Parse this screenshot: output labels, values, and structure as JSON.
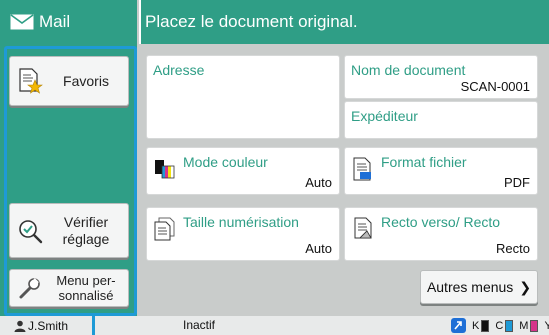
{
  "header": {
    "app_title": "Mail",
    "message": "Placez le document original."
  },
  "sidebar": {
    "favorites_label": "Favoris",
    "verify_label_1": "Vérifier",
    "verify_label_2": "réglage",
    "custom_menu_label_1": "Menu per-",
    "custom_menu_label_2": "sonnalisé"
  },
  "main": {
    "address": {
      "title": "Adresse"
    },
    "document_name": {
      "title": "Nom de document",
      "value": "SCAN-0001"
    },
    "sender": {
      "title": "Expéditeur"
    },
    "color_mode": {
      "title": "Mode couleur",
      "value": "Auto"
    },
    "file_format": {
      "title": "Format fichier",
      "value": "PDF"
    },
    "scan_size": {
      "title": "Taille numérisation",
      "value": "Auto"
    },
    "duplex": {
      "title": "Recto verso/ Recto",
      "value": "Recto"
    },
    "more_menus_label": "Autres menus"
  },
  "status_bar": {
    "user": "J.Smith",
    "state": "Inactif",
    "toner": [
      {
        "label": "K",
        "color": "#111111"
      },
      {
        "label": "C",
        "color": "#1e9ad6"
      },
      {
        "label": "M",
        "color": "#d6338a"
      },
      {
        "label": "Y",
        "color": "#f2e20f"
      }
    ]
  },
  "colors": {
    "accent_green": "#2f9e86",
    "selection_blue": "#1e9ad6",
    "panel_gray": "#c9cccb"
  }
}
